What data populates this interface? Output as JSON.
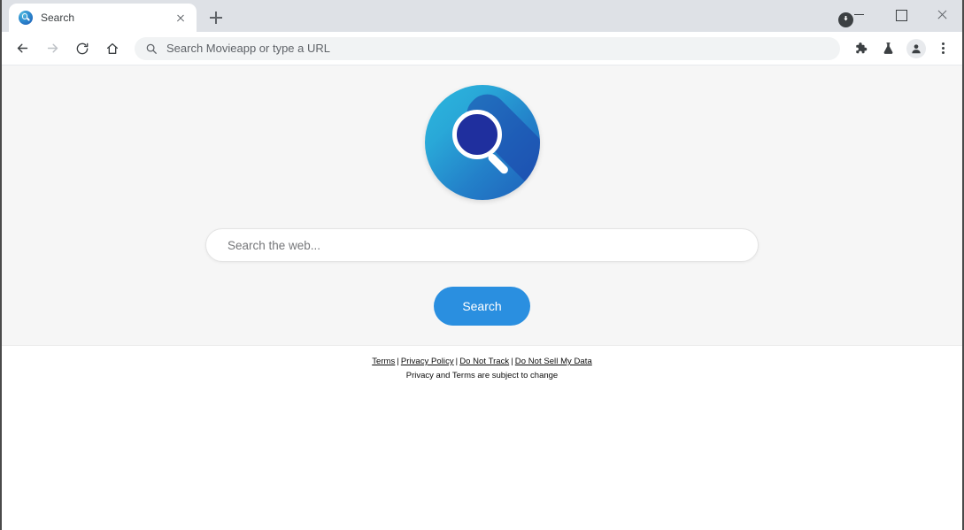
{
  "browser": {
    "tabs": [
      {
        "title": "Search",
        "favicon_icon": "search-globe-favicon",
        "close_icon": "close-icon"
      }
    ],
    "new_tab_icon": "plus-icon",
    "download_badge_icon": "download-arrow-icon",
    "window_controls": {
      "minimize_icon": "minimize-icon",
      "maximize_icon": "maximize-icon",
      "close_icon": "close-icon"
    },
    "toolbar": {
      "back_icon": "back-arrow-icon",
      "forward_icon": "forward-arrow-icon",
      "reload_icon": "reload-icon",
      "home_icon": "home-icon",
      "omnibox": {
        "search_icon": "search-icon",
        "placeholder": "Search Movieapp or type a URL",
        "value": ""
      },
      "extensions_icon": "puzzle-piece-icon",
      "experiments_icon": "beaker-icon",
      "profile_icon": "profile-avatar-icon",
      "menu_icon": "three-dot-menu-icon"
    }
  },
  "page": {
    "logo": {
      "icon": "magnifier-logo-icon",
      "gradient_from": "#2cb7dd",
      "gradient_to": "#1f5fba",
      "lens_color": "#1f2f9e"
    },
    "search": {
      "placeholder": "Search the web...",
      "value": "",
      "button_label": "Search",
      "button_color": "#2a8fe0"
    },
    "footer": {
      "links": [
        {
          "label": "Terms"
        },
        {
          "label": "Privacy Policy"
        },
        {
          "label": "Do Not Track"
        },
        {
          "label": "Do Not Sell My Data"
        }
      ],
      "separator": "|",
      "note": "Privacy and Terms are subject to change"
    }
  }
}
